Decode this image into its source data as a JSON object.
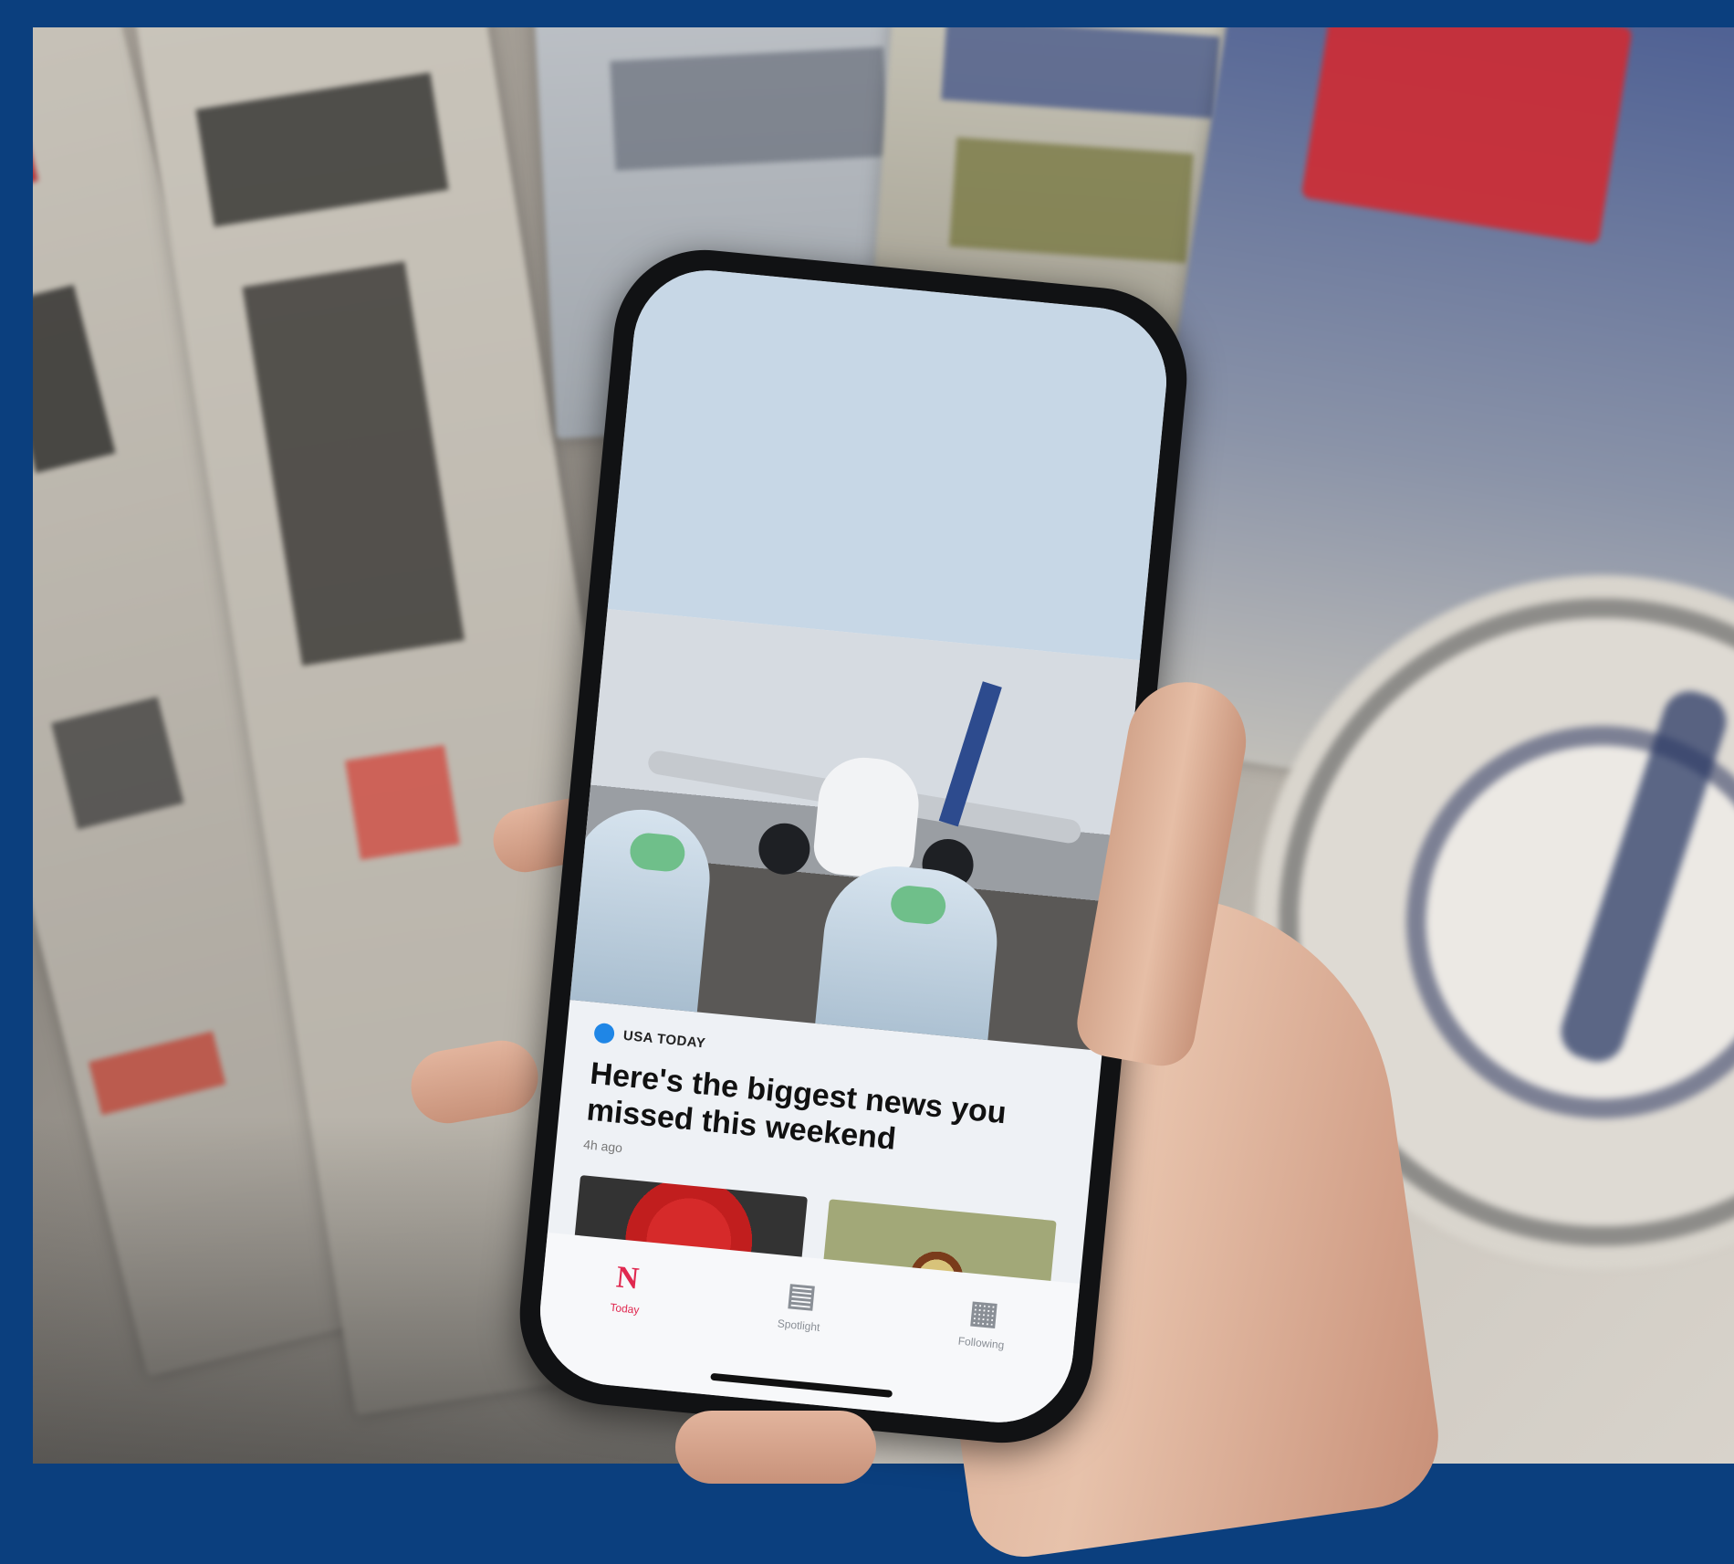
{
  "frame": {
    "border_color": "#0b3f7e"
  },
  "article": {
    "source": "USA TODAY",
    "source_color": "#1f86e6",
    "headline": "Here's the biggest news you missed this weekend",
    "time": "4h ago"
  },
  "tabbar": {
    "tabs": [
      {
        "label": "Today",
        "icon": "news-logo-icon",
        "glyph": "N",
        "active": true
      },
      {
        "label": "Spotlight",
        "icon": "spotlight-icon",
        "glyph": "▤",
        "active": false
      },
      {
        "label": "Following",
        "icon": "following-icon",
        "glyph": "▦",
        "active": false
      }
    ],
    "active_color": "#e0284f"
  }
}
